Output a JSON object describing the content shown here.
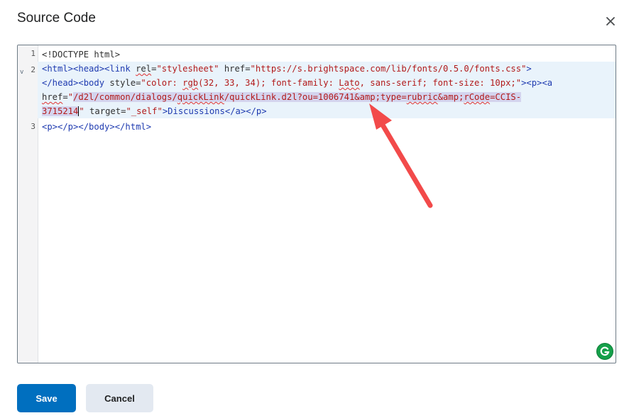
{
  "dialog": {
    "title": "Source Code",
    "save_label": "Save",
    "cancel_label": "Cancel"
  },
  "editor": {
    "line_numbers": [
      "1",
      "2",
      "3"
    ],
    "fold_marker": "v",
    "line1": "<!DOCTYPE html>",
    "line2_row1": {
      "t1": "<html><head><link ",
      "attr_rel": "rel",
      "eq1": "=",
      "val_rel": "\"stylesheet\"",
      "attr_href": " href",
      "eq2": "=",
      "val_href": "\"https://s.brightspace.com/lib/fonts/0.5.0/fonts.css\"",
      "close": ">"
    },
    "line2_row2": {
      "t1": "</head><body ",
      "attr_style": "style",
      "eq": "=",
      "val_a": "\"color: ",
      "val_rgb": "rgb",
      "val_b": "(32, 33, 34); font-family: ",
      "val_lato": "Lato",
      "val_c": ", sans-serif; font-size: 10px;\"",
      "t2": "><p><a"
    },
    "line2_row3": {
      "attr_href": "href",
      "eq": "=",
      "q": "\"",
      "p1": "/d2l/common/dialogs/",
      "p2": "quickLink",
      "p3": "/quickLink.d2l?ou=1006741&amp;type=",
      "p4": "rubric",
      "p5": "&amp;",
      "p6": "rCode",
      "p7": "=CCIS-"
    },
    "line2_row4": {
      "sel": "3715214",
      "q": "\"",
      "attr_target": " target",
      "eq": "=",
      "val_target": "\"_self\"",
      "rest": ">Discussions</a></p>"
    },
    "line3": "<p></p></body></html>"
  },
  "icons": {
    "close": "close-icon",
    "grammarly": "grammarly-icon",
    "annotation": "red-arrow"
  },
  "colors": {
    "primary": "#006fbf",
    "secondary": "#e3e9f1",
    "annotation_arrow": "#f24a4a",
    "grammarly": "#15a04a"
  }
}
